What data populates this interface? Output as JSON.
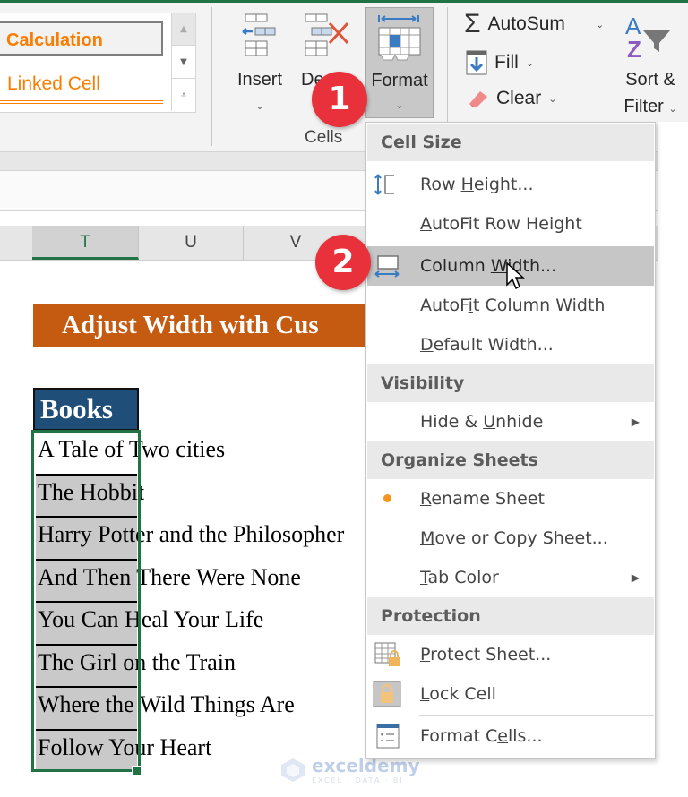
{
  "ribbon": {
    "styles_gallery": {
      "items": [
        "Calculation",
        "Linked Cell"
      ],
      "accent_color": "#fa7d00"
    },
    "cells_group": {
      "label": "Cells",
      "buttons": [
        {
          "label": "Insert"
        },
        {
          "label": "Delete",
          "visible_text": "De"
        },
        {
          "label": "Format",
          "active": true
        }
      ]
    },
    "editing_group": {
      "autosum": "AutoSum",
      "fill": "Fill",
      "clear": "Clear",
      "sort_filter_line1": "Sort &",
      "sort_filter_line2": "Filter"
    }
  },
  "columns": [
    "T",
    "U",
    "V"
  ],
  "selected_column": "T",
  "sheet": {
    "title": "Adjust Width with Custom Width",
    "title_visible": "Adjust Width with Cus",
    "table_header": "Books",
    "books": [
      "A Tale of Two cities",
      "The Hobbit",
      "Harry Potter and the Philosopher",
      "And Then There Were None",
      "You Can Heal Your Life",
      "The Girl on the Train",
      "Where the  Wild Things Are",
      "Follow Your Heart"
    ],
    "colors": {
      "title_bg": "#c55a11",
      "header_bg": "#1f4e79",
      "selection": "#217346",
      "cell_bg": "#c9c9c9"
    }
  },
  "format_menu": {
    "sections": [
      {
        "title": "Cell Size",
        "items": [
          {
            "pre": "Row ",
            "key": "H",
            "post": "eight...",
            "icon": "row-height-icon"
          },
          {
            "pre": "",
            "key": "A",
            "post": "utoFit Row Height"
          },
          {
            "pre": "Column ",
            "key": "W",
            "post": "idth...",
            "icon": "column-width-icon",
            "highlighted": true
          },
          {
            "pre": "AutoF",
            "key": "i",
            "post": "t Column Width"
          },
          {
            "pre": "",
            "key": "D",
            "post": "efault Width..."
          }
        ]
      },
      {
        "title": "Visibility",
        "items": [
          {
            "pre": "Hide & ",
            "key": "U",
            "post": "nhide",
            "submenu": true
          }
        ]
      },
      {
        "title": "Organize Sheets",
        "items": [
          {
            "pre": "",
            "key": "R",
            "post": "ename Sheet",
            "bullet": true
          },
          {
            "pre": "",
            "key": "M",
            "post": "ove or Copy Sheet..."
          },
          {
            "pre": "",
            "key": "T",
            "post": "ab Color",
            "submenu": true
          }
        ]
      },
      {
        "title": "Protection",
        "items": [
          {
            "pre": "",
            "key": "P",
            "post": "rotect Sheet...",
            "icon": "protect-sheet-icon"
          },
          {
            "pre": "",
            "key": "L",
            "post": "ock Cell",
            "icon": "lock-cell-icon"
          },
          {
            "pre": "Format C",
            "key": "e",
            "post": "lls...",
            "icon": "format-cells-icon"
          }
        ]
      }
    ]
  },
  "callouts": [
    "1",
    "2"
  ],
  "watermark": {
    "name": "exceldemy",
    "tagline": "EXCEL · DATA · BI"
  }
}
